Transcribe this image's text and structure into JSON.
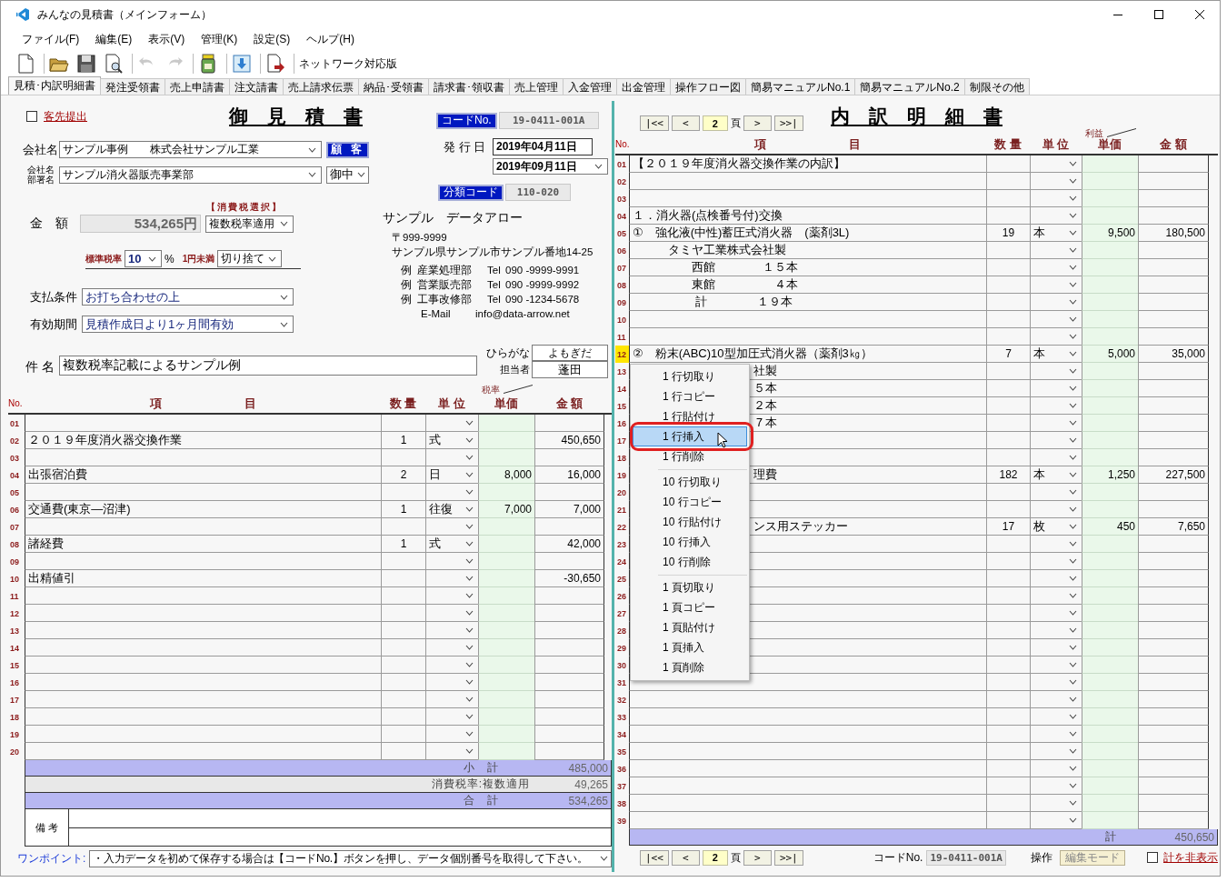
{
  "window": {
    "title": "みんなの見積書（メインフォーム）"
  },
  "menu": [
    "ファイル(F)",
    "編集(E)",
    "表示(V)",
    "管理(K)",
    "設定(S)",
    "ヘルプ(H)"
  ],
  "toolbar": {
    "buttons": [
      {
        "disabled": false
      },
      {
        "disabled": false
      },
      {
        "disabled": false
      },
      {
        "disabled": false
      },
      {
        "disabled": true
      },
      {
        "disabled": true
      },
      {
        "disabled": false
      },
      {
        "disabled": false
      },
      {
        "disabled": false
      }
    ],
    "label": "ネットワーク対応版"
  },
  "tabs": [
    {
      "label": "見積･内訳明細書",
      "selected": true
    },
    {
      "label": "発注受領書",
      "selected": false
    },
    {
      "label": "売上申請書",
      "selected": false
    },
    {
      "label": "注文請書",
      "selected": false
    },
    {
      "label": "売上請求伝票",
      "selected": false
    },
    {
      "label": "納品･受領書",
      "selected": false
    },
    {
      "label": "請求書･領収書",
      "selected": false
    },
    {
      "label": "売上管理",
      "selected": false
    },
    {
      "label": "入金管理",
      "selected": false
    },
    {
      "label": "出金管理",
      "selected": false
    },
    {
      "label": "操作フロー図",
      "selected": false
    },
    {
      "label": "簡易マニュアルNo.1",
      "selected": false
    },
    {
      "label": "簡易マニュアルNo.2",
      "selected": false
    },
    {
      "label": "制限その他",
      "selected": false
    }
  ],
  "estimate": {
    "submit_to_client": {
      "label": "客先提出",
      "checked": false
    },
    "title": "御　見　積　書",
    "code_label": "コードNo.",
    "code": "19-0411-001A",
    "company_label": "会社名",
    "company": "サンプル事例　　株式会社サンプル工業",
    "customer_button": "顧 客",
    "dept_label_lines": [
      "会社名",
      "部署名"
    ],
    "dept": "サンプル消火器販売事業部",
    "honorific": "御中",
    "issue_label": "発 行 日",
    "issue_date": "2019年04月11日",
    "valid_date": "2019年09月11日",
    "category_label": "分類コード",
    "category": "110-020",
    "tax_select_label": "【消費税選択】",
    "amount_label": "金　額",
    "amount": "534,265円",
    "tax_mode": "複数税率適用",
    "std_rate_label": "標準税率",
    "std_rate": "10",
    "percent": "%",
    "rounding_label": "1円未満",
    "rounding": "切り捨て",
    "payment_label": "支払条件",
    "payment": "お打ち合わせの上",
    "validity_label": "有効期間",
    "validity": "見積作成日より1ヶ月間有効",
    "sender": {
      "name": "サンプル　データアロー",
      "postal": "〒999-9999",
      "address": "サンプル県サンプル市サンプル番地14-25",
      "contacts": [
        {
          "prefix": "例",
          "dept": "産業処理部",
          "tel": "Tel",
          "number": "090 -9999-9991"
        },
        {
          "prefix": "例",
          "dept": "営業販売部",
          "tel": "Tel",
          "number": "090 -9999-9992"
        },
        {
          "prefix": "例",
          "dept": "工事改修部",
          "tel": "Tel",
          "number": "090 -1234-5678"
        }
      ],
      "email_label": "E-Mail",
      "email": "info@data-arrow.net"
    },
    "subject_label": "件 名",
    "subject": "複数税率記載によるサンプル例",
    "kana_label": "ひらがな",
    "kana": "よもぎだ",
    "staff_label": "担当者",
    "staff": "蓬田",
    "columns": {
      "no": "No.",
      "item": "項　　　　　　　目",
      "qty": "数 量",
      "unit": "単 位",
      "rate": "税率",
      "price": "単価",
      "amount": "金 額"
    },
    "rows": [
      {
        "no": "01",
        "selected": false
      },
      {
        "no": "02",
        "item": "２０１９年度消火器交換作業",
        "qty": "1",
        "unit": "式",
        "amount": "450,650",
        "selected": false
      },
      {
        "no": "03",
        "selected": false
      },
      {
        "no": "04",
        "item": "出張宿泊費",
        "qty": "2",
        "unit": "日",
        "price": "8,000",
        "amount": "16,000",
        "selected": false
      },
      {
        "no": "05",
        "selected": false
      },
      {
        "no": "06",
        "item": "交通費(東京―沼津)",
        "qty": "1",
        "unit": "往復",
        "price": "7,000",
        "amount": "7,000",
        "selected": false
      },
      {
        "no": "07",
        "selected": false
      },
      {
        "no": "08",
        "item": "諸経費",
        "qty": "1",
        "unit": "式",
        "amount": "42,000",
        "selected": false
      },
      {
        "no": "09",
        "selected": false
      },
      {
        "no": "10",
        "item": "出精値引",
        "amount": "-30,650",
        "selected": false
      },
      {
        "no": "11",
        "selected": false
      },
      {
        "no": "12",
        "selected": false
      },
      {
        "no": "13",
        "selected": false
      },
      {
        "no": "14",
        "selected": false
      },
      {
        "no": "15",
        "selected": false
      },
      {
        "no": "16",
        "selected": false
      },
      {
        "no": "17",
        "selected": false
      },
      {
        "no": "18",
        "selected": false
      },
      {
        "no": "19",
        "selected": false
      },
      {
        "no": "20",
        "selected": false
      }
    ],
    "totals": [
      {
        "kind": "sum",
        "label": "小　計",
        "value": "485,000"
      },
      {
        "kind": "tax",
        "label": "消費税率:複数適用",
        "value": "49,265"
      },
      {
        "kind": "sum",
        "label": "合　計",
        "value": "534,265"
      }
    ],
    "remarks_label": "備 考",
    "tip_label": "ワンポイント:",
    "tip": "・入力データを初めて保存する場合は【コードNo.】ボタンを押し、データ個別番号を取得して下さい。"
  },
  "detail": {
    "nav": {
      "first": "|<<",
      "prev": "<",
      "page": "2",
      "page_unit": "頁",
      "next": ">",
      "last": ">>|"
    },
    "title": "内　訳　明　細　書",
    "columns": {
      "no": "No.",
      "item": "項　　　　　　　目",
      "qty": "数 量",
      "unit": "単 位",
      "rate": "利益",
      "price": "単価",
      "amount": "金 額"
    },
    "rows": [
      {
        "no": "01",
        "item": "【２０１９年度消火器交換作業の内訳】",
        "selected": false
      },
      {
        "no": "02",
        "selected": false
      },
      {
        "no": "03",
        "selected": false
      },
      {
        "no": "04",
        "item": "１．消火器(点検番号付)交換",
        "selected": false
      },
      {
        "no": "05",
        "item": "①　強化液(中性)蓄圧式消火器　(薬剤3L)",
        "qty": "19",
        "unit": "本",
        "price": "9,500",
        "amount": "180,500",
        "selected": false
      },
      {
        "no": "06",
        "item": "　　　タミヤ工業株式会社製",
        "selected": false
      },
      {
        "no": "07",
        "item": "　　　　　西館　　　　１５本",
        "selected": false
      },
      {
        "no": "08",
        "item": "　　　　　東館　　　　　４本",
        "selected": false
      },
      {
        "no": "09",
        "item": "　　　　　 計　　　　 １９本",
        "selected": false
      },
      {
        "no": "10",
        "selected": false
      },
      {
        "no": "11",
        "selected": false
      },
      {
        "no": "12",
        "item": "②　粉末(ABC)10型加圧式消火器（薬剤3㎏）",
        "qty": "7",
        "unit": "本",
        "price": "5,000",
        "amount": "35,000",
        "selected": true
      },
      {
        "no": "13",
        "item": "社製",
        "selected": false
      },
      {
        "no": "14",
        "item": "５本",
        "selected": false
      },
      {
        "no": "15",
        "item": "２本",
        "selected": false
      },
      {
        "no": "16",
        "item": "７本",
        "selected": false
      },
      {
        "no": "17",
        "selected": false
      },
      {
        "no": "18",
        "selected": false
      },
      {
        "no": "19",
        "item": "理費",
        "qty": "182",
        "unit": "本",
        "price": "1,250",
        "amount": "227,500",
        "selected": false
      },
      {
        "no": "20",
        "selected": false
      },
      {
        "no": "21",
        "selected": false
      },
      {
        "no": "22",
        "item": "ンス用ステッカー",
        "qty": "17",
        "unit": "枚",
        "price": "450",
        "amount": "7,650",
        "selected": false
      },
      {
        "no": "23",
        "selected": false
      },
      {
        "no": "24",
        "selected": false
      },
      {
        "no": "25",
        "selected": false
      },
      {
        "no": "26",
        "selected": false
      },
      {
        "no": "27",
        "selected": false
      },
      {
        "no": "28",
        "selected": false
      },
      {
        "no": "29",
        "selected": false
      },
      {
        "no": "30",
        "selected": false
      },
      {
        "no": "31",
        "selected": false
      },
      {
        "no": "32",
        "selected": false
      },
      {
        "no": "33",
        "selected": false
      },
      {
        "no": "34",
        "selected": false
      },
      {
        "no": "35",
        "selected": false
      },
      {
        "no": "36",
        "selected": false
      },
      {
        "no": "37",
        "selected": false
      },
      {
        "no": "38",
        "selected": false
      },
      {
        "no": "39",
        "selected": false
      }
    ],
    "total_label": "計",
    "total": "450,650",
    "bottom_nav": {
      "first": "|<<",
      "prev": "<",
      "page": "2",
      "page_unit": "頁",
      "next": ">",
      "last": ">>|"
    },
    "code_label": "コードNo.",
    "code": "19-0411-001A",
    "op_label": "操作",
    "mode_button": {
      "label": "編集モード",
      "disabled": true
    },
    "hide_totals": {
      "label": "計を非表示",
      "checked": false
    }
  },
  "context_menu": {
    "groups": [
      {
        "items": [
          {
            "label": "1 行切取り",
            "selected": false
          },
          {
            "label": "1 行コピー",
            "selected": false
          },
          {
            "label": "1 行貼付け",
            "selected": false
          },
          {
            "label": "1 行挿入",
            "selected": true
          },
          {
            "label": "1 行削除",
            "selected": false
          }
        ]
      },
      {
        "items": [
          {
            "label": "10 行切取り",
            "selected": false
          },
          {
            "label": "10 行コピー",
            "selected": false
          },
          {
            "label": "10 行貼付け",
            "selected": false
          },
          {
            "label": "10 行挿入",
            "selected": false
          },
          {
            "label": "10 行削除",
            "selected": false
          }
        ]
      },
      {
        "items": [
          {
            "label": "1 頁切取り",
            "selected": false
          },
          {
            "label": "1 頁コピー",
            "selected": false
          },
          {
            "label": "1 頁貼付け",
            "selected": false
          },
          {
            "label": "1 頁挿入",
            "selected": false
          },
          {
            "label": "1 頁削除",
            "selected": false
          }
        ]
      }
    ]
  }
}
